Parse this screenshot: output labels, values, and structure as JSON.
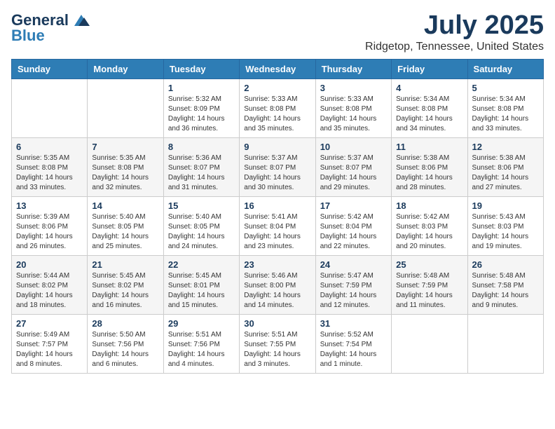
{
  "logo": {
    "line1": "General",
    "line2": "Blue"
  },
  "title": "July 2025",
  "location": "Ridgetop, Tennessee, United States",
  "days_of_week": [
    "Sunday",
    "Monday",
    "Tuesday",
    "Wednesday",
    "Thursday",
    "Friday",
    "Saturday"
  ],
  "weeks": [
    [
      {
        "day": "",
        "info": ""
      },
      {
        "day": "",
        "info": ""
      },
      {
        "day": "1",
        "info": "Sunrise: 5:32 AM\nSunset: 8:09 PM\nDaylight: 14 hours and 36 minutes."
      },
      {
        "day": "2",
        "info": "Sunrise: 5:33 AM\nSunset: 8:08 PM\nDaylight: 14 hours and 35 minutes."
      },
      {
        "day": "3",
        "info": "Sunrise: 5:33 AM\nSunset: 8:08 PM\nDaylight: 14 hours and 35 minutes."
      },
      {
        "day": "4",
        "info": "Sunrise: 5:34 AM\nSunset: 8:08 PM\nDaylight: 14 hours and 34 minutes."
      },
      {
        "day": "5",
        "info": "Sunrise: 5:34 AM\nSunset: 8:08 PM\nDaylight: 14 hours and 33 minutes."
      }
    ],
    [
      {
        "day": "6",
        "info": "Sunrise: 5:35 AM\nSunset: 8:08 PM\nDaylight: 14 hours and 33 minutes."
      },
      {
        "day": "7",
        "info": "Sunrise: 5:35 AM\nSunset: 8:08 PM\nDaylight: 14 hours and 32 minutes."
      },
      {
        "day": "8",
        "info": "Sunrise: 5:36 AM\nSunset: 8:07 PM\nDaylight: 14 hours and 31 minutes."
      },
      {
        "day": "9",
        "info": "Sunrise: 5:37 AM\nSunset: 8:07 PM\nDaylight: 14 hours and 30 minutes."
      },
      {
        "day": "10",
        "info": "Sunrise: 5:37 AM\nSunset: 8:07 PM\nDaylight: 14 hours and 29 minutes."
      },
      {
        "day": "11",
        "info": "Sunrise: 5:38 AM\nSunset: 8:06 PM\nDaylight: 14 hours and 28 minutes."
      },
      {
        "day": "12",
        "info": "Sunrise: 5:38 AM\nSunset: 8:06 PM\nDaylight: 14 hours and 27 minutes."
      }
    ],
    [
      {
        "day": "13",
        "info": "Sunrise: 5:39 AM\nSunset: 8:06 PM\nDaylight: 14 hours and 26 minutes."
      },
      {
        "day": "14",
        "info": "Sunrise: 5:40 AM\nSunset: 8:05 PM\nDaylight: 14 hours and 25 minutes."
      },
      {
        "day": "15",
        "info": "Sunrise: 5:40 AM\nSunset: 8:05 PM\nDaylight: 14 hours and 24 minutes."
      },
      {
        "day": "16",
        "info": "Sunrise: 5:41 AM\nSunset: 8:04 PM\nDaylight: 14 hours and 23 minutes."
      },
      {
        "day": "17",
        "info": "Sunrise: 5:42 AM\nSunset: 8:04 PM\nDaylight: 14 hours and 22 minutes."
      },
      {
        "day": "18",
        "info": "Sunrise: 5:42 AM\nSunset: 8:03 PM\nDaylight: 14 hours and 20 minutes."
      },
      {
        "day": "19",
        "info": "Sunrise: 5:43 AM\nSunset: 8:03 PM\nDaylight: 14 hours and 19 minutes."
      }
    ],
    [
      {
        "day": "20",
        "info": "Sunrise: 5:44 AM\nSunset: 8:02 PM\nDaylight: 14 hours and 18 minutes."
      },
      {
        "day": "21",
        "info": "Sunrise: 5:45 AM\nSunset: 8:02 PM\nDaylight: 14 hours and 16 minutes."
      },
      {
        "day": "22",
        "info": "Sunrise: 5:45 AM\nSunset: 8:01 PM\nDaylight: 14 hours and 15 minutes."
      },
      {
        "day": "23",
        "info": "Sunrise: 5:46 AM\nSunset: 8:00 PM\nDaylight: 14 hours and 14 minutes."
      },
      {
        "day": "24",
        "info": "Sunrise: 5:47 AM\nSunset: 7:59 PM\nDaylight: 14 hours and 12 minutes."
      },
      {
        "day": "25",
        "info": "Sunrise: 5:48 AM\nSunset: 7:59 PM\nDaylight: 14 hours and 11 minutes."
      },
      {
        "day": "26",
        "info": "Sunrise: 5:48 AM\nSunset: 7:58 PM\nDaylight: 14 hours and 9 minutes."
      }
    ],
    [
      {
        "day": "27",
        "info": "Sunrise: 5:49 AM\nSunset: 7:57 PM\nDaylight: 14 hours and 8 minutes."
      },
      {
        "day": "28",
        "info": "Sunrise: 5:50 AM\nSunset: 7:56 PM\nDaylight: 14 hours and 6 minutes."
      },
      {
        "day": "29",
        "info": "Sunrise: 5:51 AM\nSunset: 7:56 PM\nDaylight: 14 hours and 4 minutes."
      },
      {
        "day": "30",
        "info": "Sunrise: 5:51 AM\nSunset: 7:55 PM\nDaylight: 14 hours and 3 minutes."
      },
      {
        "day": "31",
        "info": "Sunrise: 5:52 AM\nSunset: 7:54 PM\nDaylight: 14 hours and 1 minute."
      },
      {
        "day": "",
        "info": ""
      },
      {
        "day": "",
        "info": ""
      }
    ]
  ]
}
